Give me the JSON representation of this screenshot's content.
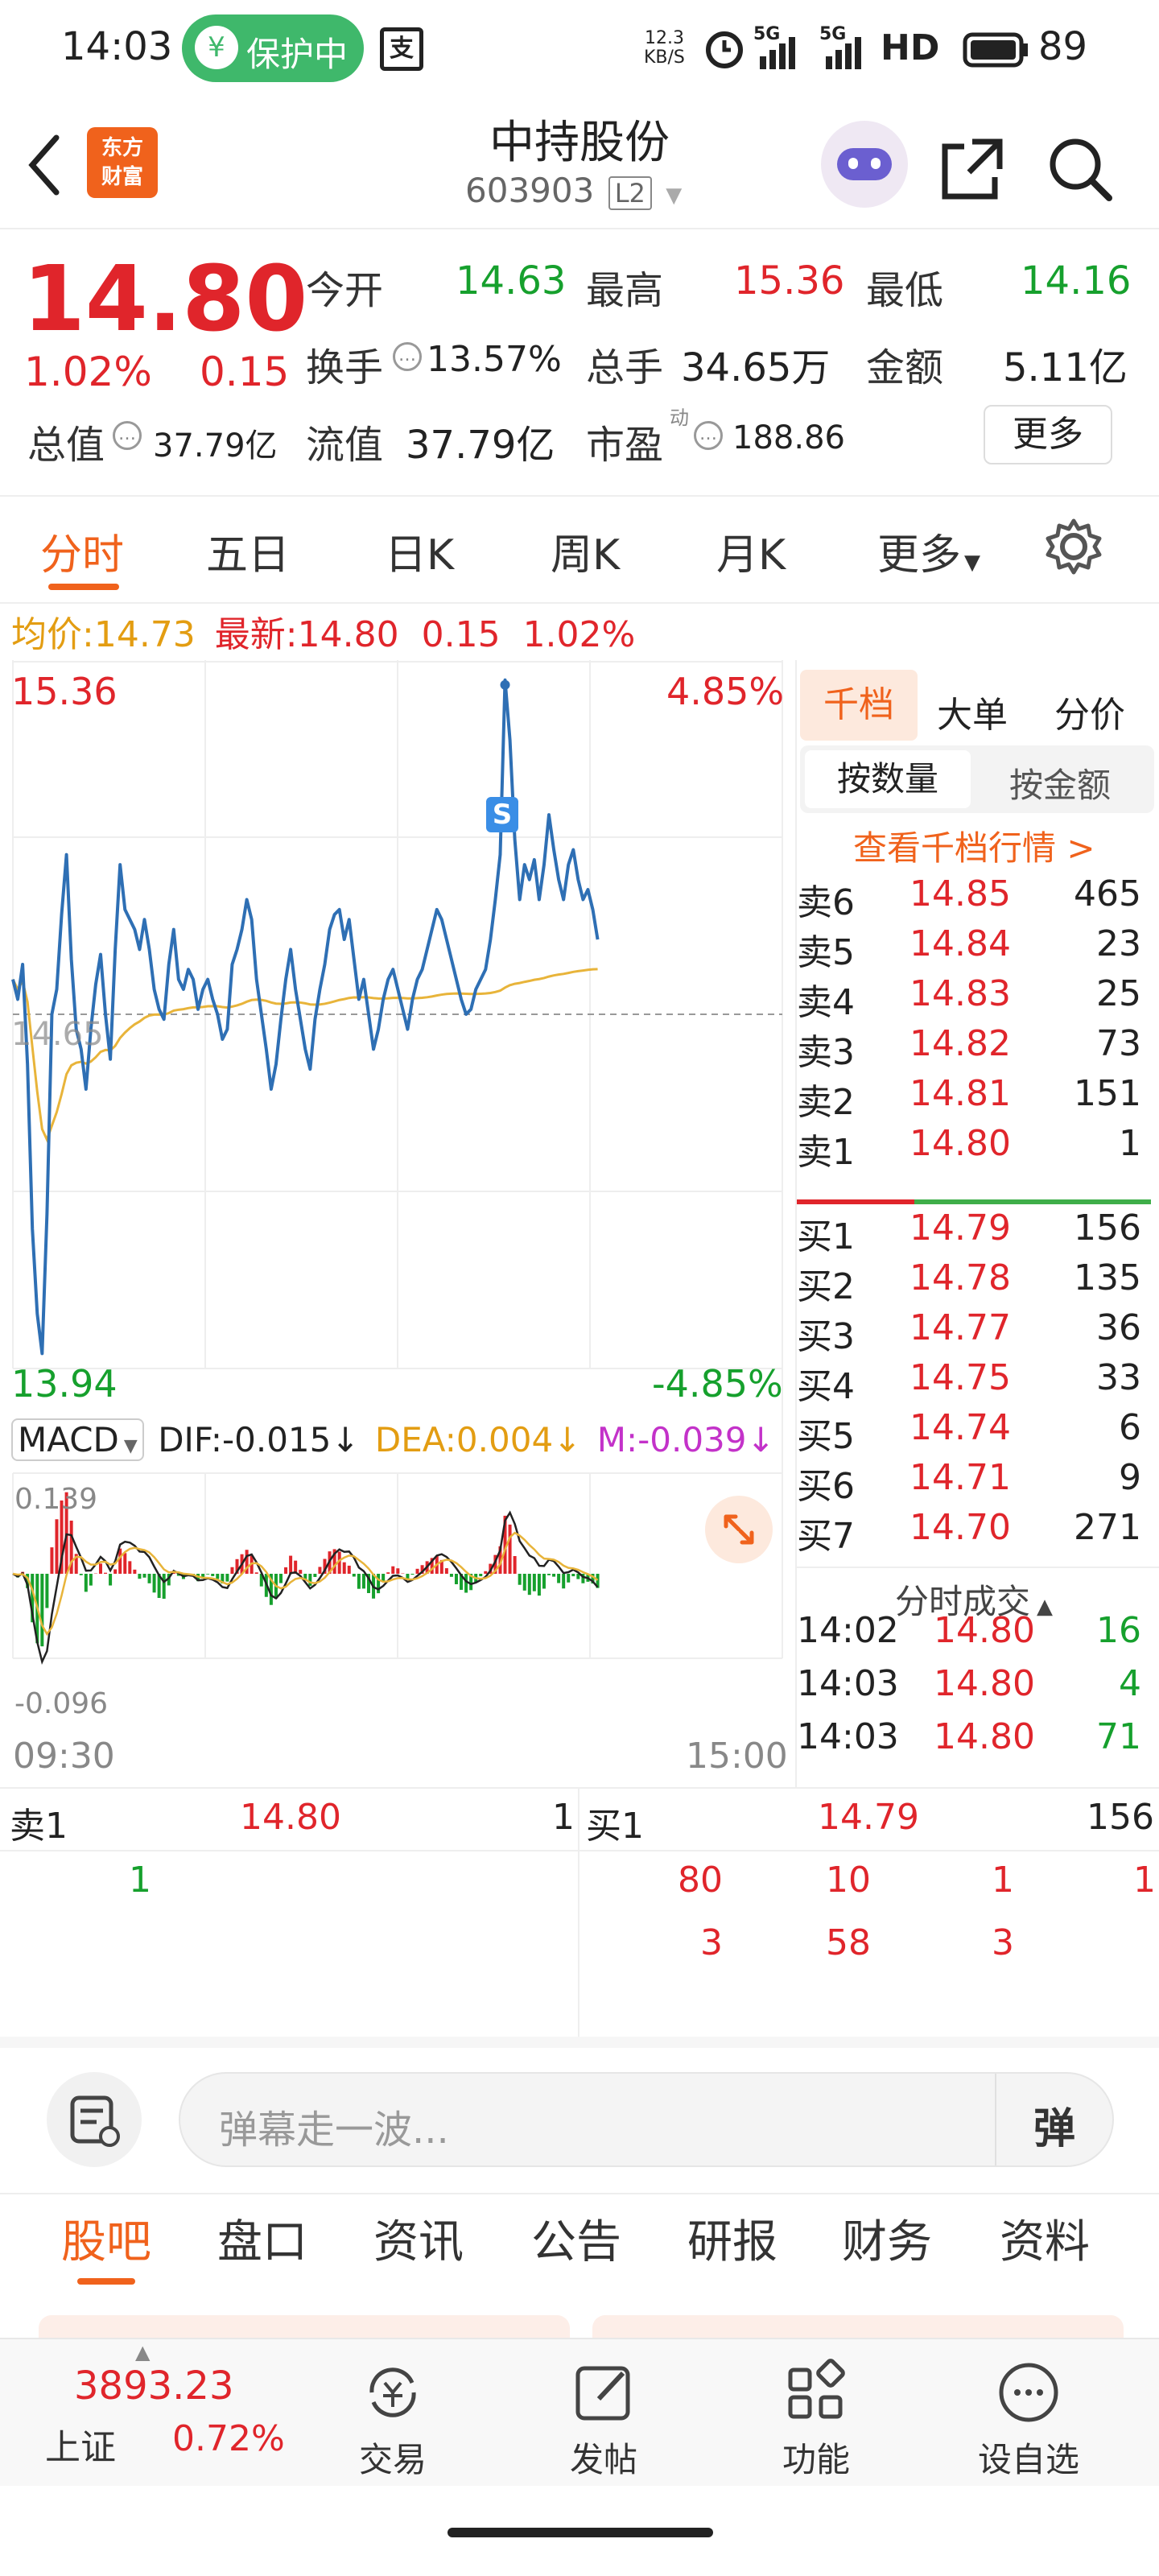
{
  "status_bar": {
    "time": "14:03",
    "protect_label": "保护中",
    "net_speed_top": "12.3",
    "net_speed_bottom": "KB/S",
    "signal1": "5G",
    "signal2": "5G",
    "hd": "HD",
    "battery": "89"
  },
  "header": {
    "logo_line1": "东方",
    "logo_line2": "财富",
    "stock_name": "中持股份",
    "stock_code": "603903",
    "level": "L2"
  },
  "quote": {
    "price": "14.80",
    "change_pct": "1.02%",
    "change": "0.15",
    "open_label": "今开",
    "open": "14.63",
    "high_label": "最高",
    "high": "15.36",
    "low_label": "最低",
    "low": "14.16",
    "turnover_label": "换手",
    "turnover": "13.57%",
    "volume_label": "总手",
    "volume": "34.65万",
    "amount_label": "金额",
    "amount": "5.11亿",
    "mktcap_label": "总值",
    "mktcap": "37.79亿",
    "float_label": "流值",
    "float_cap": "37.79亿",
    "pe_label": "市盈",
    "pe_sup": "动",
    "pe": "188.86",
    "more_button": "更多"
  },
  "chart_tabs": [
    "分时",
    "五日",
    "日K",
    "周K",
    "月K",
    "更多"
  ],
  "intraday": {
    "avg_label": "均价:",
    "avg": "14.73",
    "latest_label": "最新:",
    "latest": "14.80",
    "latest_change": "0.15",
    "latest_pct": "1.02%",
    "y_top": "15.36",
    "y_top_pct": "4.85%",
    "y_mid": "14.65",
    "y_bottom": "13.94",
    "y_bottom_pct": "-4.85%",
    "x_start": "09:30",
    "x_end": "15:00",
    "marker": "S"
  },
  "macd": {
    "label": "MACD",
    "dif": "DIF:-0.015↓",
    "dea": "DEA:0.004↓",
    "m": "M:-0.039↓",
    "top": "0.139",
    "bottom": "-0.096"
  },
  "depth": {
    "tabs": [
      "千档",
      "大单",
      "分价"
    ],
    "sub_tabs": [
      "按数量",
      "按金额"
    ],
    "view_link": "查看千档行情 >",
    "asks": [
      {
        "label": "卖6",
        "price": "14.85",
        "vol": "465"
      },
      {
        "label": "卖5",
        "price": "14.84",
        "vol": "23"
      },
      {
        "label": "卖4",
        "price": "14.83",
        "vol": "25"
      },
      {
        "label": "卖3",
        "price": "14.82",
        "vol": "73"
      },
      {
        "label": "卖2",
        "price": "14.81",
        "vol": "151"
      },
      {
        "label": "卖1",
        "price": "14.80",
        "vol": "1"
      }
    ],
    "bids": [
      {
        "label": "买1",
        "price": "14.79",
        "vol": "156"
      },
      {
        "label": "买2",
        "price": "14.78",
        "vol": "135"
      },
      {
        "label": "买3",
        "price": "14.77",
        "vol": "36"
      },
      {
        "label": "买4",
        "price": "14.75",
        "vol": "33"
      },
      {
        "label": "买5",
        "price": "14.74",
        "vol": "6"
      },
      {
        "label": "买6",
        "price": "14.71",
        "vol": "9"
      },
      {
        "label": "买7",
        "price": "14.70",
        "vol": "271"
      }
    ],
    "trades_title": "分时成交",
    "trades": [
      {
        "time": "14:02",
        "price": "14.80",
        "vol": "16"
      },
      {
        "time": "14:03",
        "price": "14.80",
        "vol": "4"
      },
      {
        "time": "14:03",
        "price": "14.80",
        "vol": "71"
      }
    ]
  },
  "queue": {
    "sell_label": "卖1",
    "sell_price": "14.80",
    "sell_total": "1",
    "sell_orders": [
      "1"
    ],
    "buy_label": "买1",
    "buy_price": "14.79",
    "buy_total": "156",
    "buy_orders_row1": [
      "80",
      "10",
      "1",
      "1"
    ],
    "buy_orders_row2": [
      "3",
      "58",
      "3"
    ]
  },
  "danmu": {
    "placeholder": "弹幕走一波...",
    "toggle": "弹"
  },
  "bottom_tabs": [
    "股吧",
    "盘口",
    "资讯",
    "公告",
    "研报",
    "财务",
    "资料"
  ],
  "nav": {
    "index_value": "3893.23",
    "index_name": "上证",
    "index_pct": "0.72%",
    "trade": "交易",
    "post": "发帖",
    "function": "功能",
    "watchlist": "设自选"
  },
  "colors": {
    "up": "#e0252b",
    "down": "#16a02d",
    "price_line": "#2e6fb4",
    "avg_line": "#e8b43a",
    "accent": "#f0621c"
  },
  "chart_data": {
    "type": "line",
    "x_range": [
      "09:30",
      "15:00"
    ],
    "ylim": [
      13.94,
      15.36
    ],
    "y_ref": 14.65,
    "series": [
      {
        "values": [
          14.72,
          14.68,
          14.75,
          14.55,
          14.22,
          14.05,
          13.97,
          14.25,
          14.65,
          14.7,
          14.85,
          14.97,
          14.76,
          14.62,
          14.58,
          14.5,
          14.62,
          14.71,
          14.77,
          14.65,
          14.56,
          14.78,
          14.95,
          14.86,
          14.84,
          14.82,
          14.78,
          14.84,
          14.78,
          14.7,
          14.66,
          14.64,
          14.75,
          14.82,
          14.72,
          14.7,
          14.74,
          14.72,
          14.66,
          14.7,
          14.72,
          14.68,
          14.65,
          14.6,
          14.62,
          14.75,
          14.78,
          14.82,
          14.88,
          14.84,
          14.72,
          14.65,
          14.58,
          14.5,
          14.55,
          14.64,
          14.72,
          14.78,
          14.7,
          14.64,
          14.58,
          14.54,
          14.64,
          14.7,
          14.75,
          14.82,
          14.85,
          14.86,
          14.8,
          14.84,
          14.76,
          14.68,
          14.72,
          14.65,
          14.58,
          14.62,
          14.68,
          14.72,
          14.74,
          14.7,
          14.66,
          14.62,
          14.68,
          14.72,
          14.74,
          14.78,
          14.82,
          14.86,
          14.84,
          14.8,
          14.76,
          14.72,
          14.68,
          14.65,
          14.66,
          14.7,
          14.72,
          14.74,
          14.8,
          14.88,
          14.97,
          15.32,
          15.2,
          15.0,
          14.88,
          14.95,
          14.92,
          14.96,
          14.88,
          14.95,
          15.05,
          14.98,
          14.92,
          14.88,
          14.95,
          14.98,
          14.92,
          14.88,
          14.9,
          14.86,
          14.8
        ]
      }
    ]
  }
}
